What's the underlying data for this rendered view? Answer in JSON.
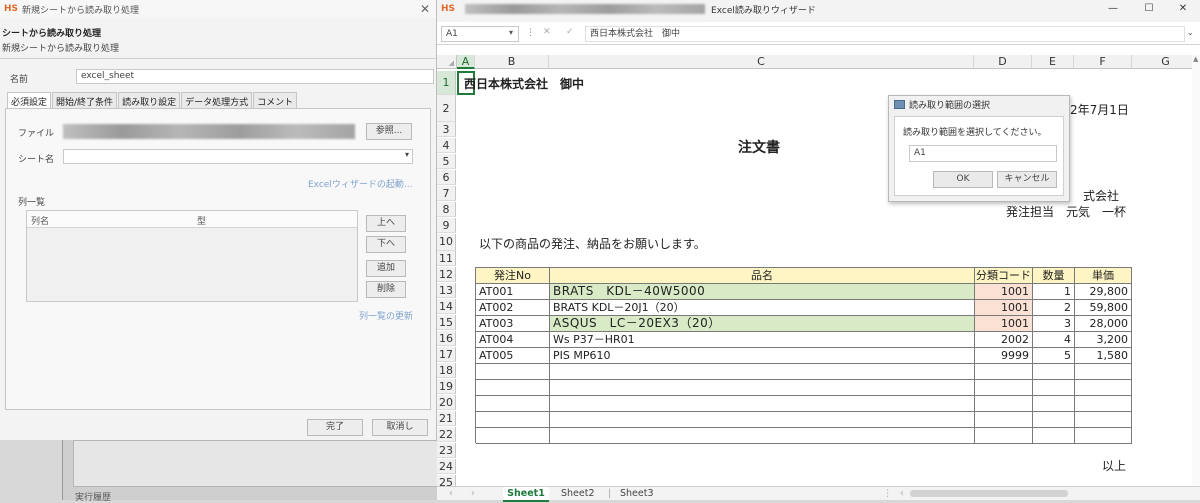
{
  "left_dialog": {
    "title": "新規シートから読み取り処理",
    "header": "シートから読み取り処理",
    "subheader": "新規シートから読み取り処理",
    "name_label": "名前",
    "name_value": "excel_sheet",
    "tabs": [
      "必須設定",
      "開始/終了条件",
      "読み取り設定",
      "データ処理方式",
      "コメント"
    ],
    "file_label": "ファイル",
    "browse_button": "参照...",
    "sheet_label": "シート名",
    "wizard_link": "Excelウィザードの起動...",
    "column_list_label": "列一覧",
    "col_header_name": "列名",
    "col_header_type": "型",
    "btn_up": "上へ",
    "btn_down": "下へ",
    "btn_add": "追加",
    "btn_delete": "削除",
    "refresh_link": "列一覧の更新",
    "ok_button": "完了",
    "cancel_button": "取消し",
    "behind_text": "実行履歴"
  },
  "excel": {
    "title": "Excel読み取りウィザード",
    "name_box": "A1",
    "formula_value": "西日本株式会社　御中",
    "columns": [
      "A",
      "B",
      "C",
      "D",
      "E",
      "F",
      "G"
    ],
    "rows": [
      "1",
      "2",
      "3",
      "4",
      "5",
      "6",
      "7",
      "8",
      "9",
      "10",
      "11",
      "12",
      "13",
      "14",
      "15",
      "16",
      "17",
      "18",
      "19",
      "20",
      "21",
      "22",
      "23",
      "24",
      "25"
    ],
    "cells": {
      "a1": "西日本株式会社　御中",
      "f2": "2年7月1日",
      "c4": "注文書",
      "f7": "式会社",
      "f8": "発注担当　元気　一杯",
      "a10": "以下の商品の発注、納品をお願いします。",
      "f24": "以上"
    },
    "table_headers": [
      "発注No",
      "品名",
      "分類コード",
      "数量",
      "単価"
    ],
    "table_rows": [
      [
        "AT001",
        "BRATS　KDL－40W5000",
        "1001",
        "1",
        "29,800"
      ],
      [
        "AT002",
        "BRATS KDL－20J1（20）",
        "1001",
        "2",
        "59,800"
      ],
      [
        "AT003",
        "ASQUS　LC－20EX3（20）",
        "1001",
        "3",
        "28,000"
      ],
      [
        "AT004",
        "Ws P37－HR01",
        "2002",
        "4",
        "3,200"
      ],
      [
        "AT005",
        "PIS MP610",
        "9999",
        "5",
        "1,580"
      ]
    ],
    "sheet_tabs": [
      "Sheet1",
      "Sheet2",
      "Sheet3"
    ],
    "active_sheet": "Sheet1"
  },
  "range_dialog": {
    "title": "読み取り範囲の選択",
    "prompt": "読み取り範囲を選択してください。",
    "value": "A1",
    "ok_button": "OK",
    "cancel_button": "キャンセル"
  },
  "colors": {
    "accent_orange": "#e0692b",
    "header_yellow": "#fff5c4",
    "highlight_green": "#d9ebc6",
    "highlight_peach": "#fbe1d4",
    "excel_green": "#1f7a3c"
  }
}
